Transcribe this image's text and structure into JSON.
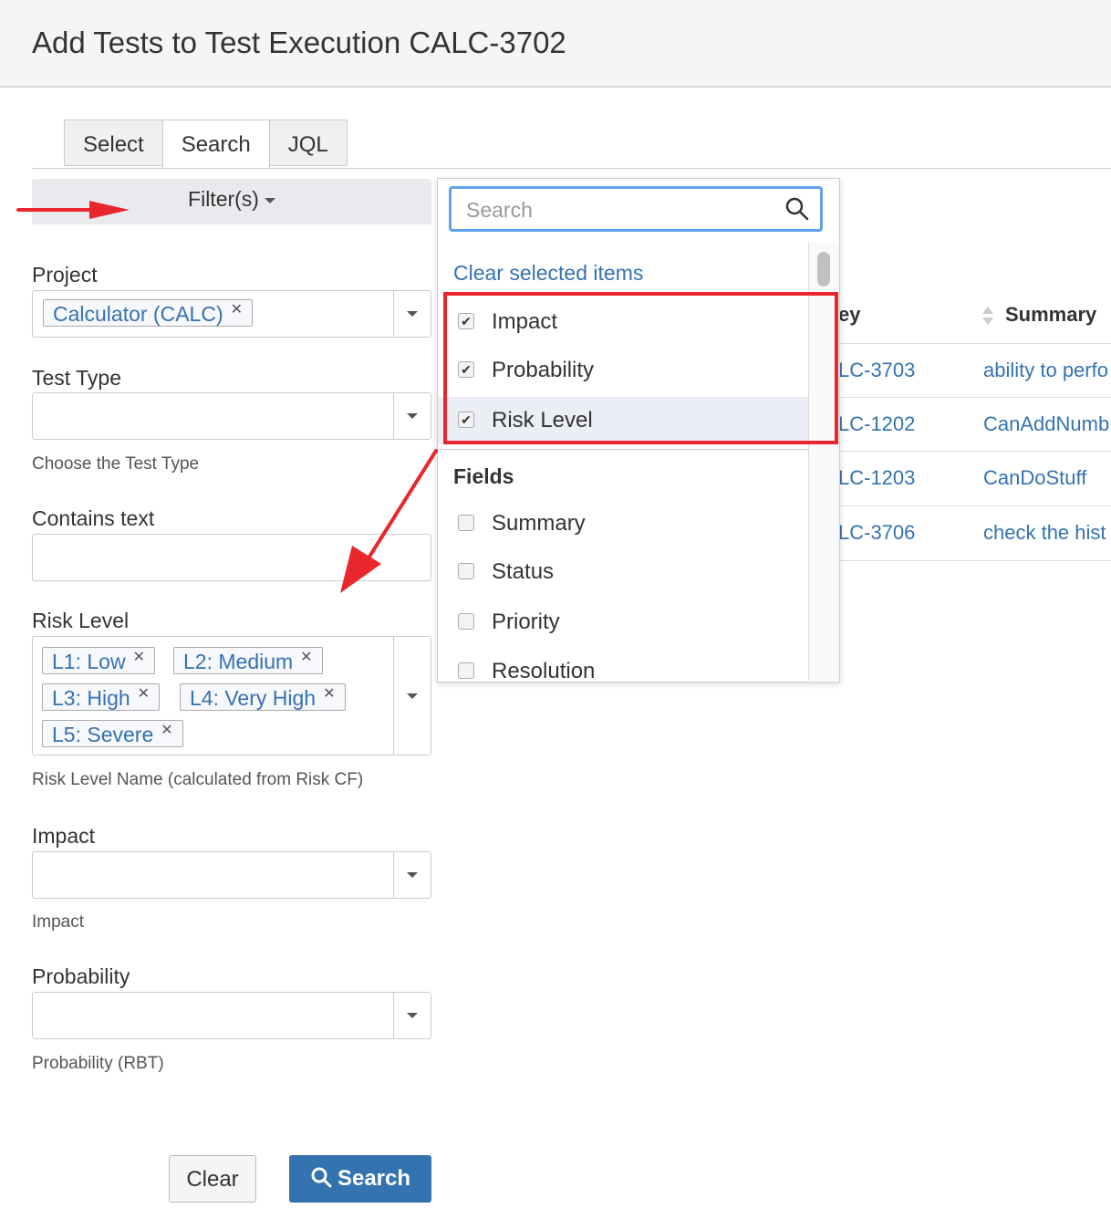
{
  "dialog": {
    "title": "Add Tests to Test Execution CALC-3702"
  },
  "tabs": [
    {
      "label": "Select",
      "active": false
    },
    {
      "label": "Search",
      "active": true
    },
    {
      "label": "JQL",
      "active": false
    }
  ],
  "filters": {
    "label": "Filter(s)"
  },
  "form": {
    "project": {
      "label": "Project",
      "chips": [
        "Calculator (CALC)"
      ]
    },
    "test_type": {
      "label": "Test Type",
      "value": "",
      "description": "Choose the Test Type"
    },
    "contains_text": {
      "label": "Contains text",
      "value": ""
    },
    "risk_level": {
      "label": "Risk Level",
      "chips": [
        "L1: Low",
        "L2: Medium",
        "L3: High",
        "L4: Very High",
        "L5: Severe"
      ],
      "description": "Risk Level Name (calculated from Risk CF)"
    },
    "impact": {
      "label": "Impact",
      "value": "",
      "description": "Impact"
    },
    "probability": {
      "label": "Probability",
      "value": "",
      "description": "Probability (RBT)"
    }
  },
  "dropdown": {
    "search_placeholder": "Search",
    "clear_label": "Clear selected items",
    "selected": [
      {
        "label": "Impact",
        "checked": true
      },
      {
        "label": "Probability",
        "checked": true
      },
      {
        "label": "Risk Level",
        "checked": true
      }
    ],
    "section_label": "Fields",
    "fields": [
      {
        "label": "Summary",
        "checked": false
      },
      {
        "label": "Status",
        "checked": false
      },
      {
        "label": "Priority",
        "checked": false
      },
      {
        "label": "Resolution",
        "checked": false
      }
    ]
  },
  "table": {
    "headers": {
      "key": "ey",
      "summary": "Summary"
    },
    "rows": [
      {
        "key": "LC-3703",
        "summary": "ability to perfo"
      },
      {
        "key": "LC-1202",
        "summary": "CanAddNumb"
      },
      {
        "key": "LC-1203",
        "summary": "CanDoStuff"
      },
      {
        "key": "LC-3706",
        "summary": "check the hist"
      }
    ]
  },
  "buttons": {
    "clear": "Clear",
    "search": "Search"
  },
  "colors": {
    "accent": "#3572b0",
    "annotation_red": "#e8262b",
    "focus_blue": "#5ea3f0"
  }
}
